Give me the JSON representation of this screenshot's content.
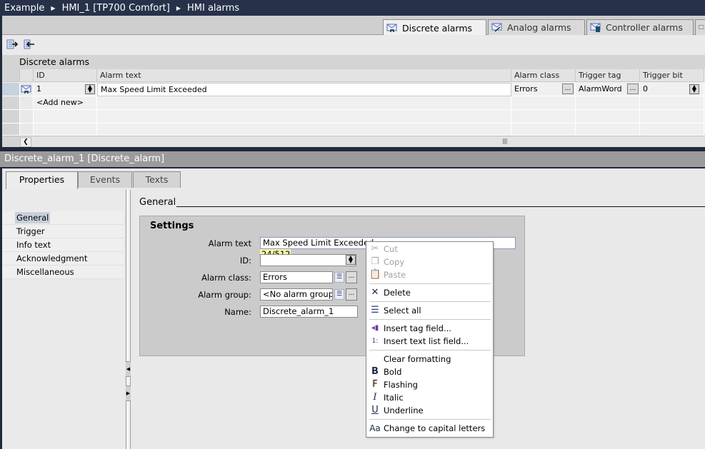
{
  "breadcrumb": [
    "Example",
    "HMI_1 [TP700 Comfort]",
    "HMI alarms"
  ],
  "editor_tabs": [
    {
      "label": "Discrete alarms",
      "icon": "discrete-alarm-icon",
      "active": true
    },
    {
      "label": "Analog alarms",
      "icon": "analog-alarm-icon",
      "active": false
    },
    {
      "label": "Controller alarms",
      "icon": "controller-alarm-icon",
      "active": false
    }
  ],
  "toolbar": {
    "export_icon": "export-icon",
    "import_icon": "import-icon"
  },
  "table": {
    "title": "Discrete alarms",
    "columns": [
      "ID",
      "Alarm text",
      "Alarm class",
      "Trigger tag",
      "Trigger bit"
    ],
    "rows": [
      {
        "id": "1",
        "alarm_text": "Max Speed Limit Exceeded",
        "alarm_class": "Errors",
        "trigger_tag": "AlarmWord",
        "trigger_bit": "0"
      }
    ],
    "add_new": "<Add new>"
  },
  "inspector": {
    "title": "Discrete_alarm_1 [Discrete_alarm]",
    "tabs": [
      "Properties",
      "Events",
      "Texts"
    ],
    "active_tab": "Properties",
    "nav": [
      "General",
      "Trigger",
      "Info text",
      "Acknowledgment",
      "Miscellaneous"
    ],
    "selected_nav": "General",
    "section_title": "General",
    "group_title": "Settings",
    "fields": {
      "alarm_text_label": "Alarm text",
      "alarm_text_value": "Max Speed Limit Exceeded",
      "char_count": "24/512",
      "id_label": "ID:",
      "id_value": "",
      "alarm_class_label": "Alarm class:",
      "alarm_class_value": "Errors",
      "alarm_group_label": "Alarm group:",
      "alarm_group_value": "<No alarm group>",
      "name_label": "Name:",
      "name_value": "Discrete_alarm_1"
    }
  },
  "context_menu": [
    {
      "label": "Cut",
      "icon": "cut-icon",
      "enabled": false
    },
    {
      "label": "Copy",
      "icon": "copy-icon",
      "enabled": false
    },
    {
      "label": "Paste",
      "icon": "paste-icon",
      "enabled": false
    },
    {
      "label": "Delete",
      "icon": "delete-icon",
      "enabled": true
    },
    {
      "label": "Select all",
      "icon": "select-all-icon",
      "enabled": true
    },
    {
      "label": "Insert tag field...",
      "icon": "tag-field-icon",
      "enabled": true
    },
    {
      "label": "Insert text list field...",
      "icon": "text-list-icon",
      "enabled": true
    },
    {
      "label": "Clear formatting",
      "icon": "",
      "enabled": true
    },
    {
      "label": "Bold",
      "icon": "bold-icon",
      "enabled": true
    },
    {
      "label": "Flashing",
      "icon": "flashing-icon",
      "enabled": true
    },
    {
      "label": "Italic",
      "icon": "italic-icon",
      "enabled": true
    },
    {
      "label": "Underline",
      "icon": "underline-icon",
      "enabled": true
    },
    {
      "label": "Change to capital letters",
      "icon": "capitalize-icon",
      "enabled": true
    }
  ]
}
